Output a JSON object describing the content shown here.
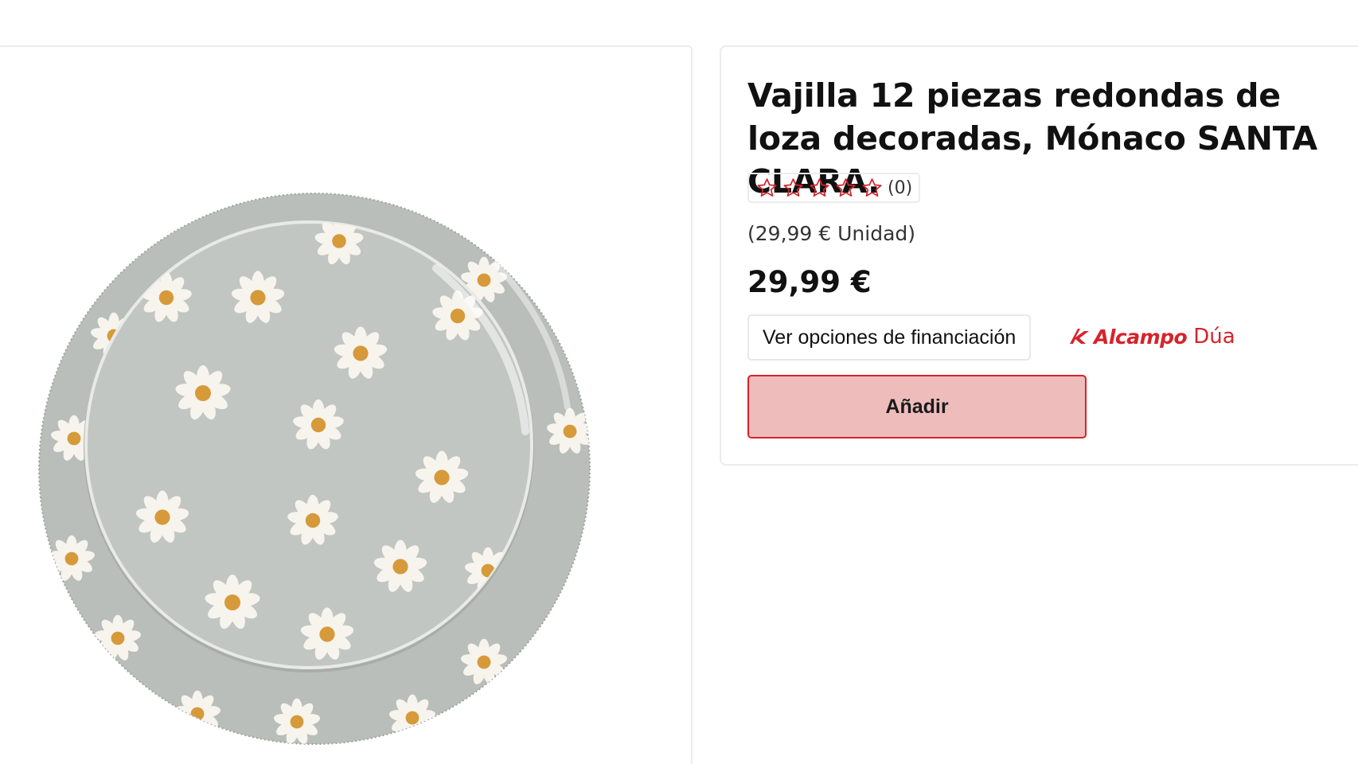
{
  "product": {
    "title": "Vajilla 12 piezas redondas de loza decoradas, Mónaco SANTA CLARA.",
    "image_alt": "plates-with-daisies-image",
    "rating": {
      "stars": 0,
      "max_stars": 5,
      "count_label": "(0)"
    },
    "unit_price_label": "(29,99 € Unidad)",
    "price": "29,99 €"
  },
  "actions": {
    "finance_label": "Ver opciones de financiación",
    "add_label": "Añadir"
  },
  "brand": {
    "name": "Alcampo",
    "suffix": "Dúa",
    "color": "#d6232a"
  },
  "colors": {
    "accent": "#d6232a",
    "add_button_bg": "#efbcbc",
    "plate_gray": "#b7bcb8"
  }
}
